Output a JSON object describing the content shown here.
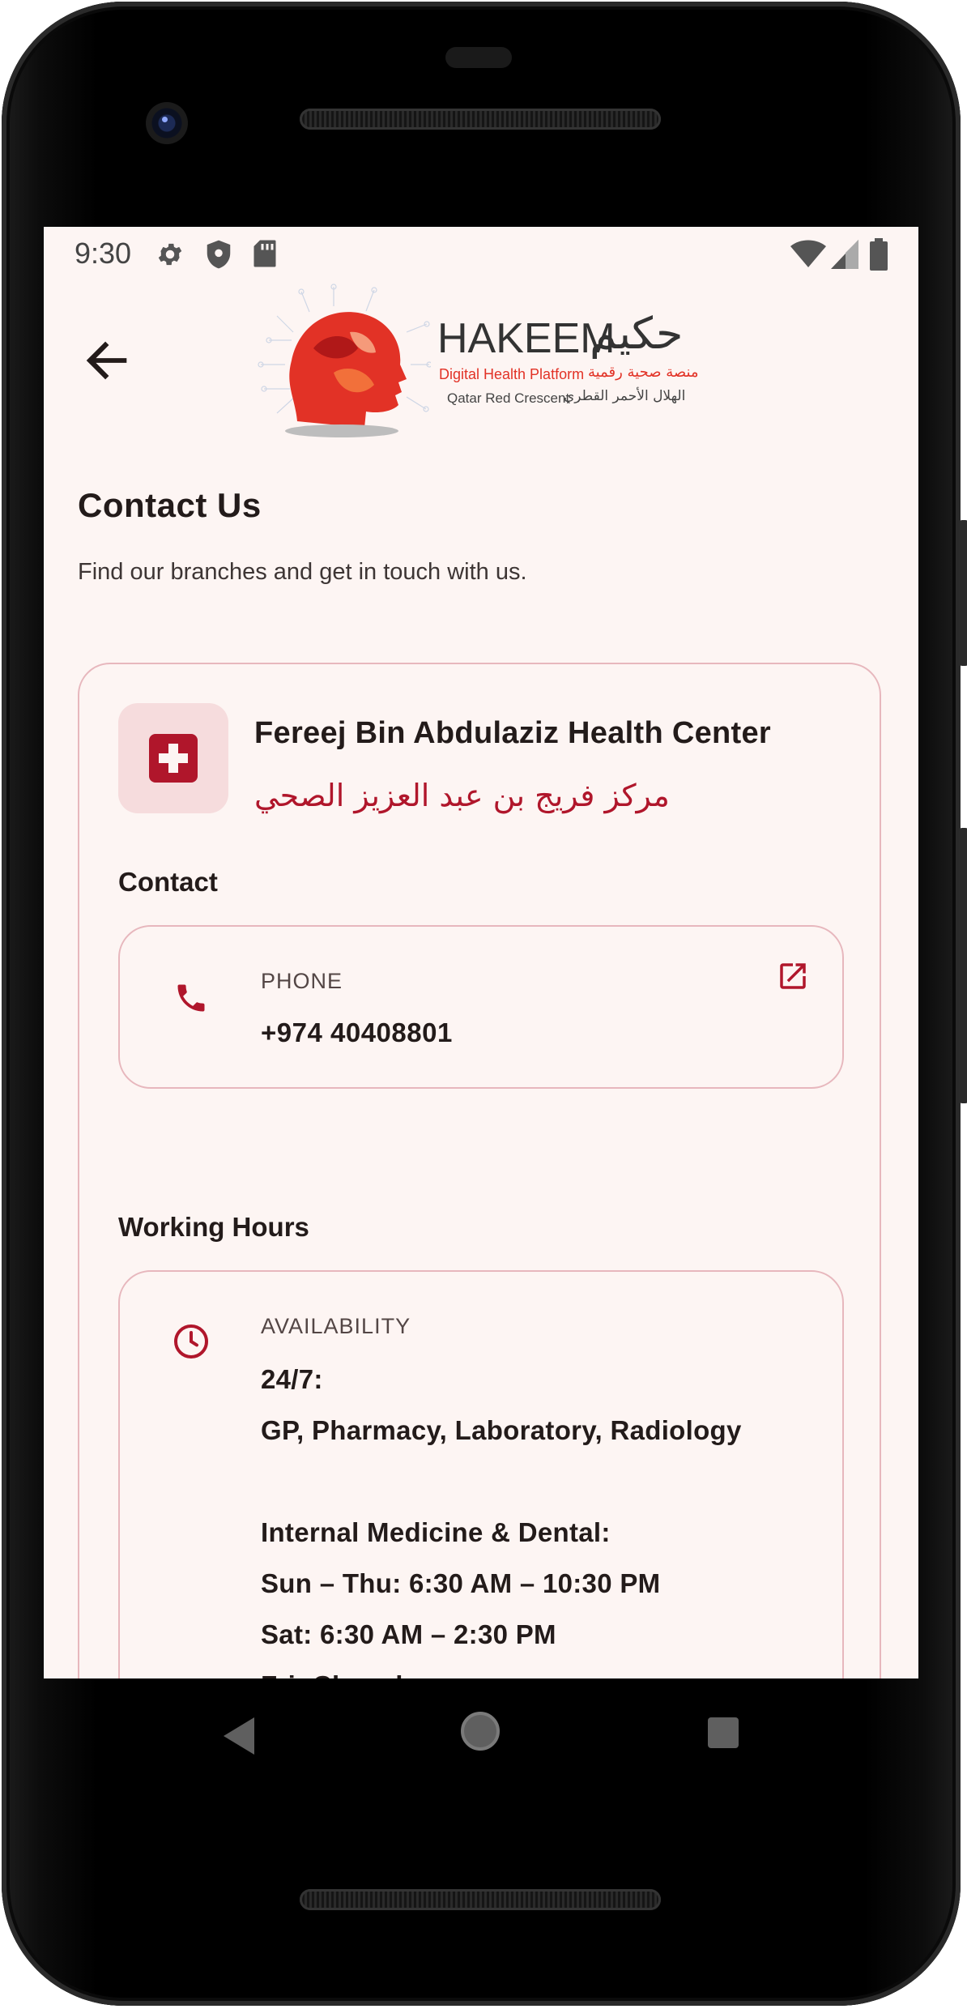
{
  "status_bar": {
    "time": "9:30",
    "left_icons": [
      "settings-gear-icon",
      "shield-icon",
      "sd-card-icon"
    ],
    "right_icons": [
      "wifi-icon",
      "cellular-signal-icon",
      "battery-icon"
    ]
  },
  "header": {
    "back_icon": "arrow-back-icon",
    "logo": {
      "name_en": "HAKEEM",
      "name_ar": "حكيم",
      "tagline_en": "Digital Health Platform",
      "tagline_ar": "منصة صحية رقمية",
      "org_en": "Qatar Red Crescent",
      "org_ar": "الهلال الأحمر القطري"
    }
  },
  "page": {
    "title": "Contact Us",
    "subtitle": "Find our branches and get in touch with us."
  },
  "branch": {
    "icon": "medical-cross-icon",
    "name_en": "Fereej Bin Abdulaziz Health Center",
    "name_ar": "مركز فريج بن عبد العزيز الصحي",
    "contact_section_label": "Contact",
    "phone": {
      "icon": "phone-icon",
      "label": "PHONE",
      "value": "+974 40408801",
      "action_icon": "open-external-icon"
    },
    "hours_section_label": "Working Hours",
    "availability": {
      "icon": "clock-icon",
      "label": "AVAILABILITY",
      "lines": [
        "24/7:",
        "GP, Pharmacy, Laboratory, Radiology",
        "",
        "Internal Medicine & Dental:",
        "Sun – Thu: 6:30 AM – 10:30 PM",
        "Sat: 6:30 AM – 2:30 PM",
        "Fri: Closed"
      ]
    }
  },
  "nav_bar": {
    "buttons": [
      "nav-back-icon",
      "nav-home-icon",
      "nav-recents-icon"
    ]
  },
  "colors": {
    "accent": "#b0162b",
    "background": "#fdf5f3",
    "border": "#e7b7bd",
    "icon_box": "#f6dcdd"
  }
}
